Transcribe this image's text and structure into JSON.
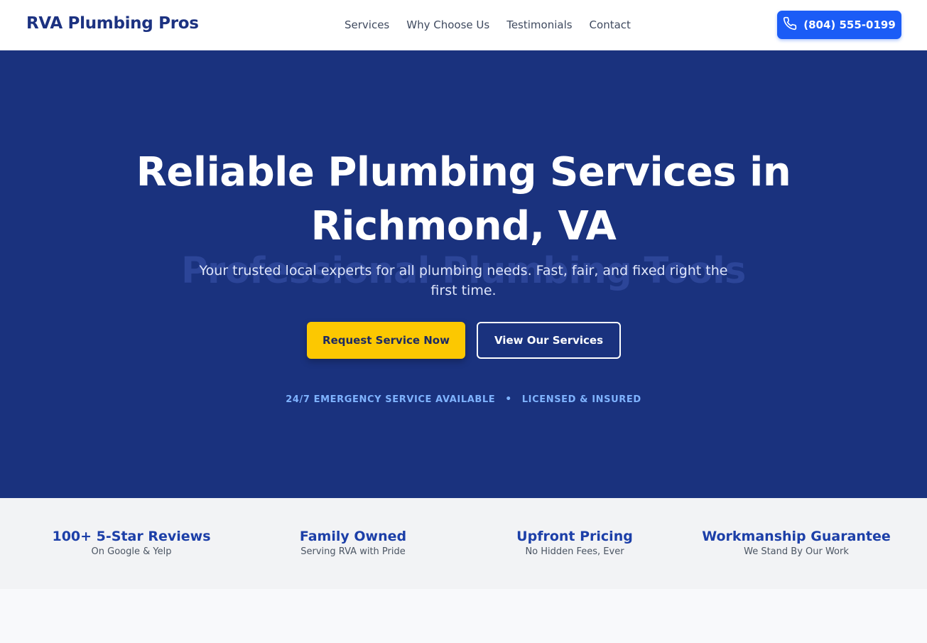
{
  "header": {
    "logo": "RVA Plumbing Pros",
    "nav": [
      "Services",
      "Why Choose Us",
      "Testimonials",
      "Contact"
    ],
    "phone_label": "(804) 555-0199",
    "phone_icon": "phone-icon"
  },
  "hero": {
    "title": "Reliable Plumbing Services in Richmond, VA",
    "watermark": "Professional Plumbing Tools",
    "subtitle": "Your trusted local experts for all plumbing needs. Fast, fair, and fixed right the first time.",
    "primary_cta": "Request Service Now",
    "secondary_cta": "View Our Services",
    "badge_left": "24/7 EMERGENCY SERVICE AVAILABLE",
    "badge_separator": "•",
    "badge_right": "LICENSED & INSURED"
  },
  "features": [
    {
      "title": "100+ 5-Star Reviews",
      "subtitle": "On Google & Yelp"
    },
    {
      "title": "Family Owned",
      "subtitle": "Serving RVA with Pride"
    },
    {
      "title": "Upfront Pricing",
      "subtitle": "No Hidden Fees, Ever"
    },
    {
      "title": "Workmanship Guarantee",
      "subtitle": "We Stand By Our Work"
    }
  ],
  "colors": {
    "brand_navy": "#1a327e",
    "accent_blue": "#1b5cf6",
    "cta_yellow": "#fcc801",
    "feature_blue": "#1c3fa8"
  }
}
